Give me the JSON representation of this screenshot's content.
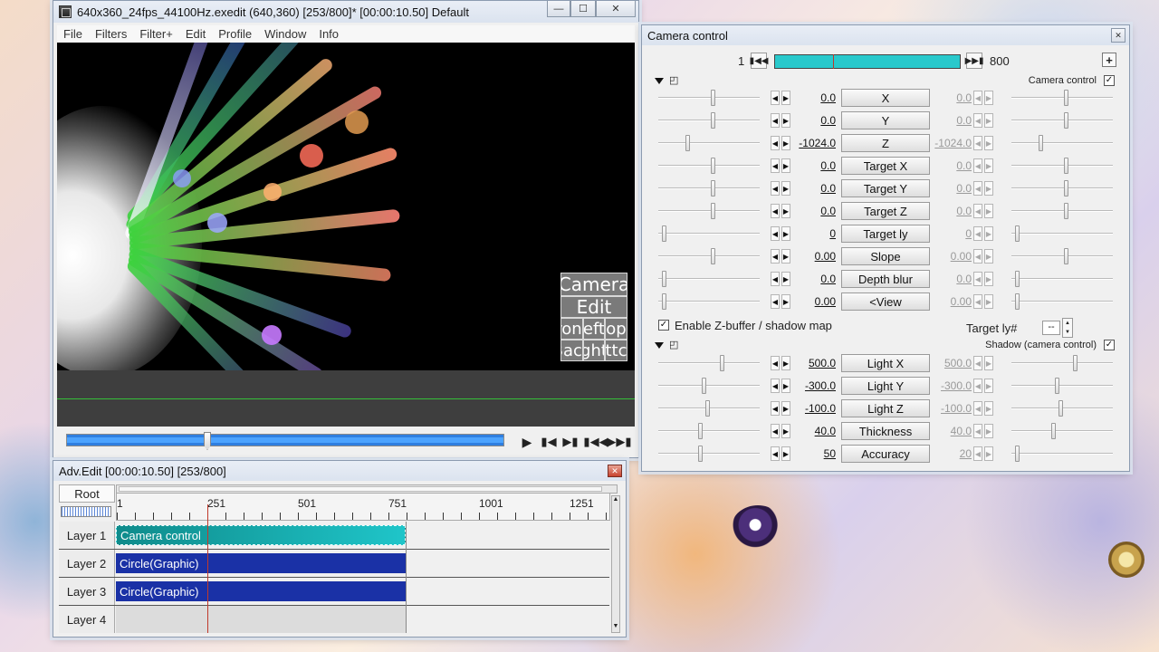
{
  "main_window": {
    "title": "640x360_24fps_44100Hz.exedit (640,360)  [253/800]*  [00:00:10.50]  Default",
    "menu": [
      "File",
      "Filters",
      "Filter+",
      "Edit",
      "Profile",
      "Window",
      "Info"
    ],
    "overlay_buttons": [
      "Camera",
      "Edit",
      "ront",
      "eft",
      "op",
      "Back",
      "ght",
      "ttc"
    ]
  },
  "adv_edit": {
    "title": "Adv.Edit [00:00:10.50] [253/800]",
    "root_label": "Root",
    "ruler": [
      "1",
      "251",
      "501",
      "751",
      "1001",
      "1251"
    ],
    "layers": [
      {
        "label": "Layer 1",
        "clip": "Camera control",
        "color": "#1aa7ad"
      },
      {
        "label": "Layer 2",
        "clip": "Circle(Graphic)",
        "color": "#1a31a6"
      },
      {
        "label": "Layer 3",
        "clip": "Circle(Graphic)",
        "color": "#1a31a6"
      },
      {
        "label": "Layer 4",
        "clip": "",
        "color": ""
      }
    ]
  },
  "camera": {
    "title": "Camera control",
    "start": "1",
    "end": "800",
    "add_button": "+",
    "section1_label": "Camera control",
    "section2_label": "Shadow (camera control)",
    "zbuffer_label": "Enable Z-buffer / shadow map",
    "target_layer_label": "Target ly#",
    "target_layer_value": "--",
    "params": [
      {
        "name": "X",
        "left": "0.0",
        "right": "0.0"
      },
      {
        "name": "Y",
        "left": "0.0",
        "right": "0.0"
      },
      {
        "name": "Z",
        "left": "-1024.0",
        "right": "-1024.0"
      },
      {
        "name": "Target X",
        "left": "0.0",
        "right": "0.0"
      },
      {
        "name": "Target Y",
        "left": "0.0",
        "right": "0.0"
      },
      {
        "name": "Target Z",
        "left": "0.0",
        "right": "0.0"
      },
      {
        "name": "Target ly",
        "left": "0",
        "right": "0"
      },
      {
        "name": "Slope",
        "left": "0.00",
        "right": "0.00"
      },
      {
        "name": "Depth blur",
        "left": "0.0",
        "right": "0.0"
      },
      {
        "name": "<View",
        "left": "0.00",
        "right": "0.00"
      }
    ],
    "shadow_params": [
      {
        "name": "Light X",
        "left": "500.0",
        "right": "500.0"
      },
      {
        "name": "Light Y",
        "left": "-300.0",
        "right": "-300.0"
      },
      {
        "name": "Light Z",
        "left": "-100.0",
        "right": "-100.0"
      },
      {
        "name": "Thickness",
        "left": "40.0",
        "right": "40.0"
      },
      {
        "name": "Accuracy",
        "left": "50",
        "right": "20"
      }
    ]
  },
  "colors": {
    "accent_bar": "#2aa3d4",
    "camera_timebar": "#29c9cc",
    "playhead": "#c0392b"
  }
}
